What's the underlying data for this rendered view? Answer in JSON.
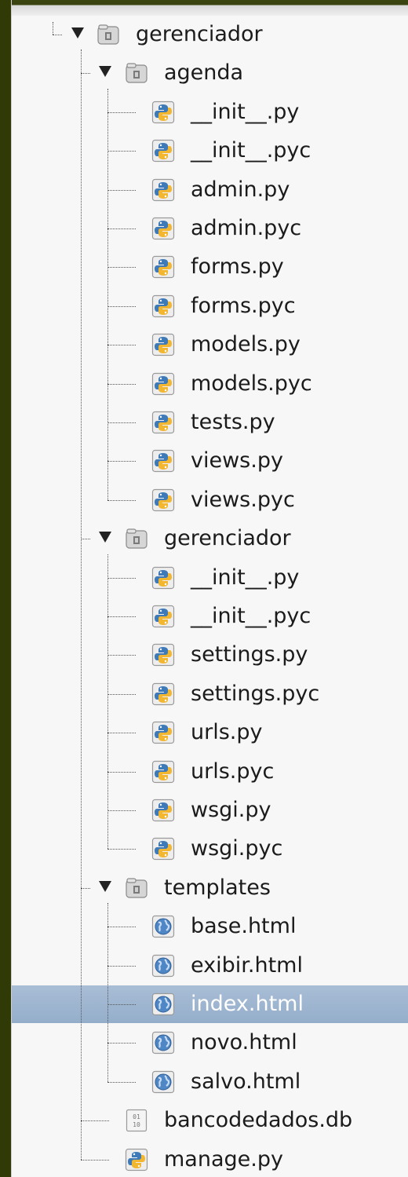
{
  "tree": {
    "root": {
      "label": "gerenciador",
      "icon": "folder-icon",
      "expanded": true
    },
    "folders": [
      {
        "label": "agenda",
        "icon": "folder-icon",
        "expanded": true,
        "files": [
          {
            "label": "__init__.py",
            "icon": "python-file-icon"
          },
          {
            "label": "__init__.pyc",
            "icon": "python-file-icon"
          },
          {
            "label": "admin.py",
            "icon": "python-file-icon"
          },
          {
            "label": "admin.pyc",
            "icon": "python-file-icon"
          },
          {
            "label": "forms.py",
            "icon": "python-file-icon"
          },
          {
            "label": "forms.pyc",
            "icon": "python-file-icon"
          },
          {
            "label": "models.py",
            "icon": "python-file-icon"
          },
          {
            "label": "models.pyc",
            "icon": "python-file-icon"
          },
          {
            "label": "tests.py",
            "icon": "python-file-icon"
          },
          {
            "label": "views.py",
            "icon": "python-file-icon"
          },
          {
            "label": "views.pyc",
            "icon": "python-file-icon"
          }
        ]
      },
      {
        "label": "gerenciador",
        "icon": "folder-icon",
        "expanded": true,
        "files": [
          {
            "label": "__init__.py",
            "icon": "python-file-icon"
          },
          {
            "label": "__init__.pyc",
            "icon": "python-file-icon"
          },
          {
            "label": "settings.py",
            "icon": "python-file-icon"
          },
          {
            "label": "settings.pyc",
            "icon": "python-file-icon"
          },
          {
            "label": "urls.py",
            "icon": "python-file-icon"
          },
          {
            "label": "urls.pyc",
            "icon": "python-file-icon"
          },
          {
            "label": "wsgi.py",
            "icon": "python-file-icon"
          },
          {
            "label": "wsgi.pyc",
            "icon": "python-file-icon"
          }
        ]
      },
      {
        "label": "templates",
        "icon": "folder-icon",
        "expanded": true,
        "files": [
          {
            "label": "base.html",
            "icon": "html-globe-icon"
          },
          {
            "label": "exibir.html",
            "icon": "html-globe-icon"
          },
          {
            "label": "index.html",
            "icon": "html-globe-icon",
            "selected": true
          },
          {
            "label": "novo.html",
            "icon": "html-globe-icon"
          },
          {
            "label": "salvo.html",
            "icon": "html-globe-icon"
          }
        ]
      }
    ],
    "root_files": [
      {
        "label": "bancodedados.db",
        "icon": "binary-file-icon"
      },
      {
        "label": "manage.py",
        "icon": "python-file-icon"
      }
    ]
  }
}
